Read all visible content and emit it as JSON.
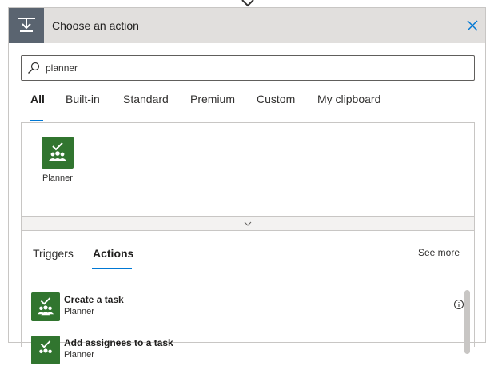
{
  "header": {
    "title": "Choose an action",
    "icon": "step-icon",
    "close_icon": "close-icon"
  },
  "search": {
    "value": "planner",
    "icon": "search-icon"
  },
  "tabs": [
    {
      "label": "All",
      "active": true
    },
    {
      "label": "Built-in",
      "active": false
    },
    {
      "label": "Standard",
      "active": false
    },
    {
      "label": "Premium",
      "active": false
    },
    {
      "label": "Custom",
      "active": false
    },
    {
      "label": "My clipboard",
      "active": false
    }
  ],
  "connectors": [
    {
      "label": "Planner",
      "color": "#31752f",
      "icon": "planner-icon"
    }
  ],
  "actions_panel": {
    "sub_tabs": [
      {
        "label": "Triggers",
        "active": false
      },
      {
        "label": "Actions",
        "active": true
      }
    ],
    "see_more": "See more",
    "items": [
      {
        "title": "Create a task",
        "connector": "Planner"
      },
      {
        "title": "Add assignees to a task",
        "connector": "Planner"
      }
    ]
  },
  "colors": {
    "accent": "#0078d4",
    "planner": "#31752f",
    "header_bg": "#e1dfdd"
  }
}
